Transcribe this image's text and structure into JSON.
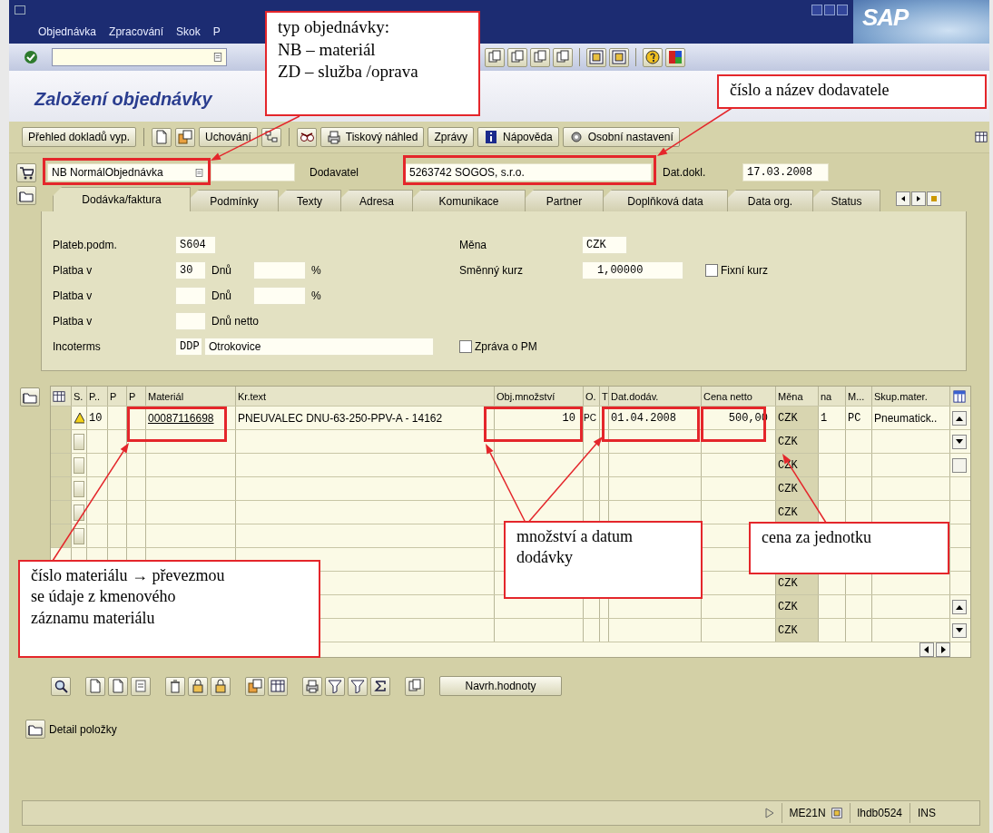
{
  "window": {
    "menu": [
      "Objednávka",
      "Zpracování",
      "Skok",
      "P"
    ],
    "logo": "SAP"
  },
  "title": "Založení objednávky",
  "app_toolbar": [
    {
      "label": "Přehled dokladů vyp.",
      "has_icon": false
    },
    {
      "label": "Uchování",
      "has_icon": false
    },
    {
      "label": "Tiskový náhled",
      "has_icon": true
    },
    {
      "label": "Zprávy",
      "has_icon": false
    },
    {
      "label": "Nápověda",
      "has_icon": true
    },
    {
      "label": "Osobní nastavení",
      "has_icon": true
    }
  ],
  "header": {
    "doc_type": "NB NormálObjednávka",
    "supplier_label": "Dodavatel",
    "supplier": "5263742 SOGOS, s.r.o.",
    "date_label": "Dat.dokl.",
    "date": "17.03.2008"
  },
  "tabs": [
    {
      "label": "Dodávka/faktura",
      "selected": true
    },
    {
      "label": "Podmínky",
      "selected": false
    },
    {
      "label": "Texty",
      "selected": false
    },
    {
      "label": "Adresa",
      "selected": false
    },
    {
      "label": "Komunikace",
      "selected": false
    },
    {
      "label": "Partner",
      "selected": false
    },
    {
      "label": "Doplňková data",
      "selected": false
    },
    {
      "label": "Data org.",
      "selected": false
    },
    {
      "label": "Status",
      "selected": false
    }
  ],
  "payment_rows": [
    {
      "kind": "key",
      "label": "Plateb.podm.",
      "value": "S604"
    },
    {
      "kind": "days_percent",
      "label": "Platba v",
      "days": "30",
      "days_label": "Dnů",
      "percent": "%"
    },
    {
      "kind": "days_percent",
      "label": "Platba v",
      "days_label": "Dnů",
      "percent": "%"
    },
    {
      "kind": "days_net",
      "label": "Platba v",
      "days_label": "Dnů netto"
    },
    {
      "kind": "incoterms",
      "label": "Incoterms",
      "code": "DDP",
      "place": "Otrokovice"
    }
  ],
  "currency": {
    "label": "Měna",
    "value": "CZK"
  },
  "exchange": {
    "label": "Směnný kurz",
    "value": "1,00000",
    "fixed_label": "Fixní kurz",
    "fixed_checked": false
  },
  "pm_message": {
    "label": "Zpráva o PM",
    "checked": false
  },
  "table": {
    "columns": [
      "S.",
      "P..",
      "P",
      "P",
      "Materiál",
      "Kr.text",
      "Obj.množství",
      "O.",
      "T",
      "Dat.dodáv.",
      "Cena netto",
      "Měna",
      "na",
      "M...",
      "Skup.mater."
    ],
    "rows": [
      {
        "warning": true,
        "item": "10",
        "material": "00087116698",
        "text": "PNEUVALEC DNU-63-250-PPV-A - 14162",
        "qty": "10",
        "unit": "PC",
        "date": "01.04.2008",
        "price": "500,00",
        "currency": "CZK",
        "per": "1",
        "price_unit": "PC",
        "group": "Pneumatick.."
      },
      {
        "warning": false,
        "currency": "CZK"
      },
      {
        "warning": false,
        "currency": "CZK"
      },
      {
        "warning": false,
        "currency": "CZK"
      },
      {
        "warning": false,
        "currency": "CZK"
      },
      {
        "warning": false
      },
      {},
      {
        "currency": "CZK"
      },
      {
        "currency": "CZK"
      },
      {
        "currency": "CZK"
      }
    ]
  },
  "table_toolbar": {
    "button": "Navrh.hodnoty"
  },
  "detail_button": "Detail položky",
  "status_bar": {
    "transaction": "ME21N",
    "server": "lhdb0524",
    "mode": "INS"
  },
  "annotations": [
    {
      "text": "typ objednávky:\nNB – materiál\nZD – služba /oprava"
    },
    {
      "text": "číslo a název dodavatele"
    },
    {
      "text": "číslo materiálu → převezmou\nse údaje z kmenového\nzáznamu materiálu"
    },
    {
      "text": "množství a datum\ndodávky"
    },
    {
      "text": "cena za jednotku"
    }
  ]
}
